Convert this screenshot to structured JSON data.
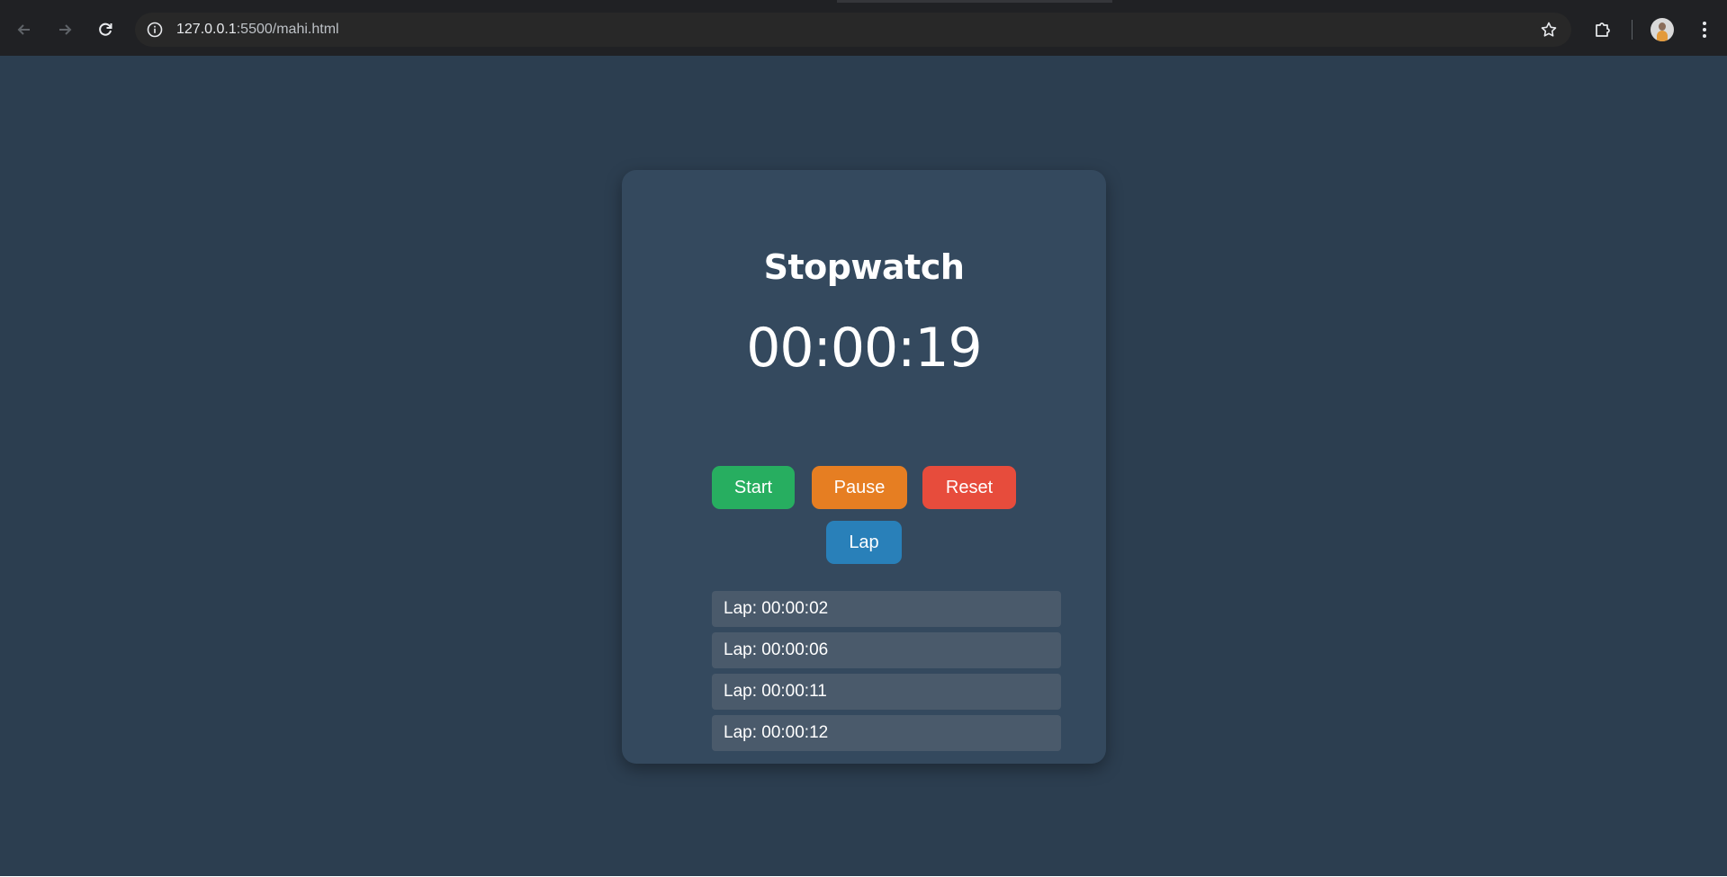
{
  "browser": {
    "url_host": "127.0.0.1",
    "url_rest": ":5500/mahi.html",
    "icons": {
      "back": "back-arrow-icon",
      "forward": "forward-arrow-icon",
      "reload": "reload-icon",
      "site_info": "info-icon",
      "bookmark": "star-icon",
      "extensions": "puzzle-icon",
      "profile": "avatar",
      "menu": "kebab-menu-icon"
    }
  },
  "app": {
    "title": "Stopwatch",
    "time": "00:00:19",
    "buttons": {
      "start": "Start",
      "pause": "Pause",
      "reset": "Reset",
      "lap": "Lap"
    },
    "laps": [
      "Lap: 00:00:02",
      "Lap: 00:00:06",
      "Lap: 00:00:11",
      "Lap: 00:00:12"
    ]
  },
  "colors": {
    "page_bg": "#2c3e50",
    "card_bg": "#34495e",
    "start": "#27ae60",
    "pause": "#e67e22",
    "reset": "#e74c3c",
    "lap": "#2980b9",
    "lap_item_bg": "#4a5a6b"
  }
}
